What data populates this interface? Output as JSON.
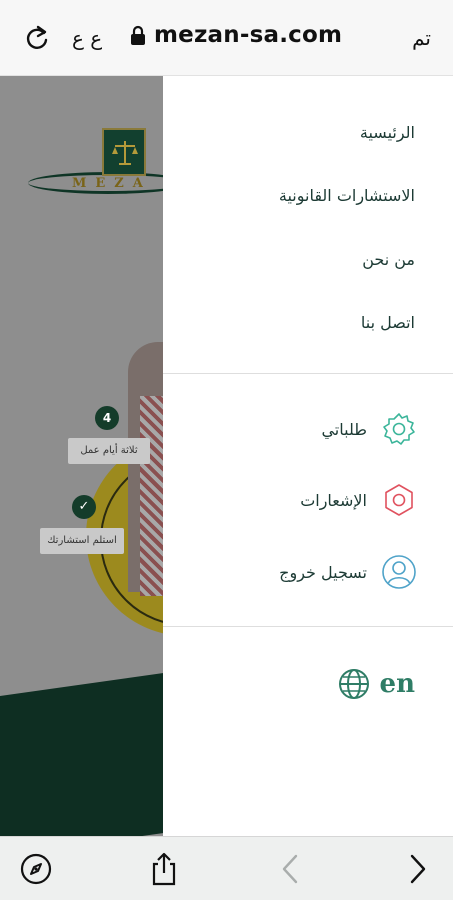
{
  "browser": {
    "done_label": "تم",
    "url": "mezan-sa.com",
    "text_size_label": "ع ع",
    "icons": {
      "lock": "lock-icon",
      "reload": "reload-icon",
      "compass": "compass-icon",
      "share": "share-icon",
      "back": "chevron-left-icon",
      "forward": "chevron-right-icon"
    }
  },
  "site": {
    "logo_text": "MEZA",
    "steps": [
      {
        "badge": "4",
        "label": "ثلاثة أيام عمل"
      },
      {
        "badge": "✓",
        "label": "استلم استشارتك"
      }
    ]
  },
  "menu": {
    "nav_items": [
      {
        "label": "الرئيسية"
      },
      {
        "label": "الاستشارات القانونية"
      },
      {
        "label": "من نحن"
      },
      {
        "label": "اتصل بنا"
      }
    ],
    "account_items": [
      {
        "label": "طلباتي",
        "icon": "gear-icon",
        "color": "#3bb59a"
      },
      {
        "label": "الإشعارات",
        "icon": "hexagon-icon",
        "color": "#e0525f"
      },
      {
        "label": "تسجيل خروج",
        "icon": "user-icon",
        "color": "#4fa3c9"
      }
    ],
    "language": {
      "label": "en",
      "icon": "globe-icon",
      "color": "#2f7d66"
    }
  }
}
